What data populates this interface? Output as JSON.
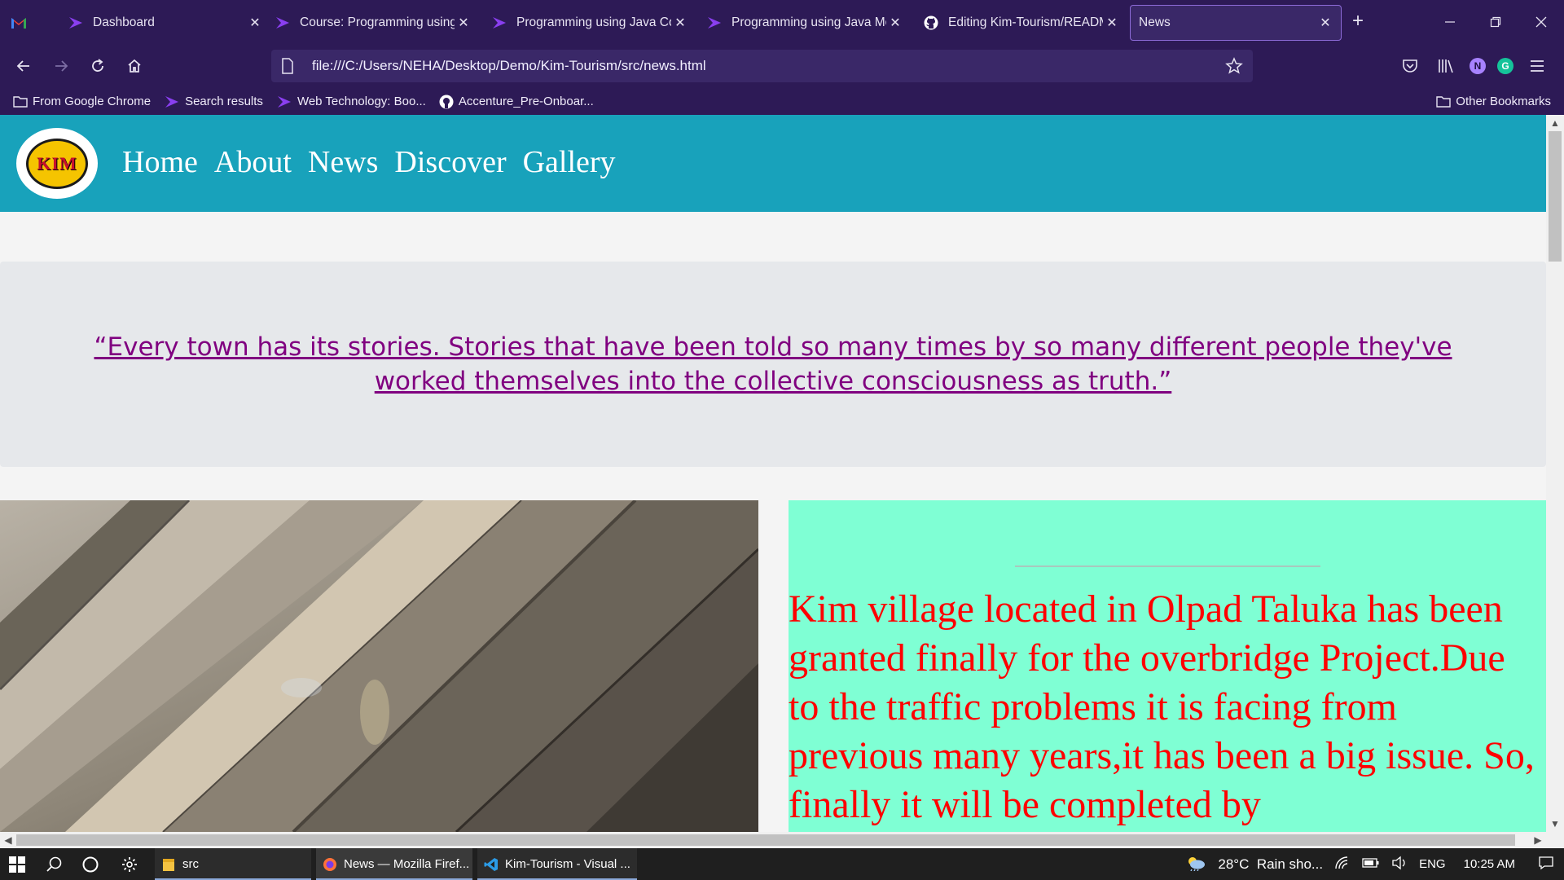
{
  "browser": {
    "tabs": [
      {
        "label": "Dashboard",
        "icon": "gmail-icon",
        "active": false
      },
      {
        "label": "Course: Programming using Java",
        "icon": "course-icon",
        "active": false
      },
      {
        "label": "Programming using Java Con",
        "icon": "course-icon",
        "active": false
      },
      {
        "label": "Programming using Java Mo",
        "icon": "course-icon",
        "active": false
      },
      {
        "label": "Editing Kim-Tourism/READM",
        "icon": "github-icon",
        "active": false
      },
      {
        "label": "News",
        "icon": "",
        "active": true
      }
    ],
    "url": "file:///C:/Users/NEHA/Desktop/Demo/Kim-Tourism/src/news.html",
    "profile_initial": "N",
    "grammarly_initial": "G",
    "bookmarks": [
      {
        "label": "From Google Chrome",
        "icon": "folder-icon"
      },
      {
        "label": "Search results",
        "icon": "course-icon"
      },
      {
        "label": "Web Technology: Boo...",
        "icon": "course-icon"
      },
      {
        "label": "Accenture_Pre-Onboar...",
        "icon": "github-icon"
      }
    ],
    "other_bookmarks": "Other Bookmarks"
  },
  "page": {
    "logo_text": "KIM",
    "nav": [
      "Home",
      "About",
      "News",
      "Discover",
      "Gallery"
    ],
    "quote": "“Every town has its stories. Stories that have been told so many times by so many different people they've worked themselves into the collective consciousness as truth.”",
    "news_text": "Kim village located in Olpad Taluka has been granted finally for the overbridge Project.Due to the traffic problems it is facing from previous many years,it has been a big issue. So, finally it will be completed by",
    "colors": {
      "header_bg": "#18a2bb",
      "quote_color": "#800080",
      "news_bg": "#7fffd4",
      "news_text_color": "#ff0000"
    }
  },
  "taskbar": {
    "apps": [
      {
        "label": "src",
        "icon": "folder-icon"
      },
      {
        "label": "News — Mozilla Firef...",
        "icon": "firefox-icon"
      },
      {
        "label": "Kim-Tourism - Visual ...",
        "icon": "vscode-icon"
      }
    ],
    "weather": "28°C  Rain sho...",
    "language": "ENG",
    "time": "10:25 AM"
  }
}
